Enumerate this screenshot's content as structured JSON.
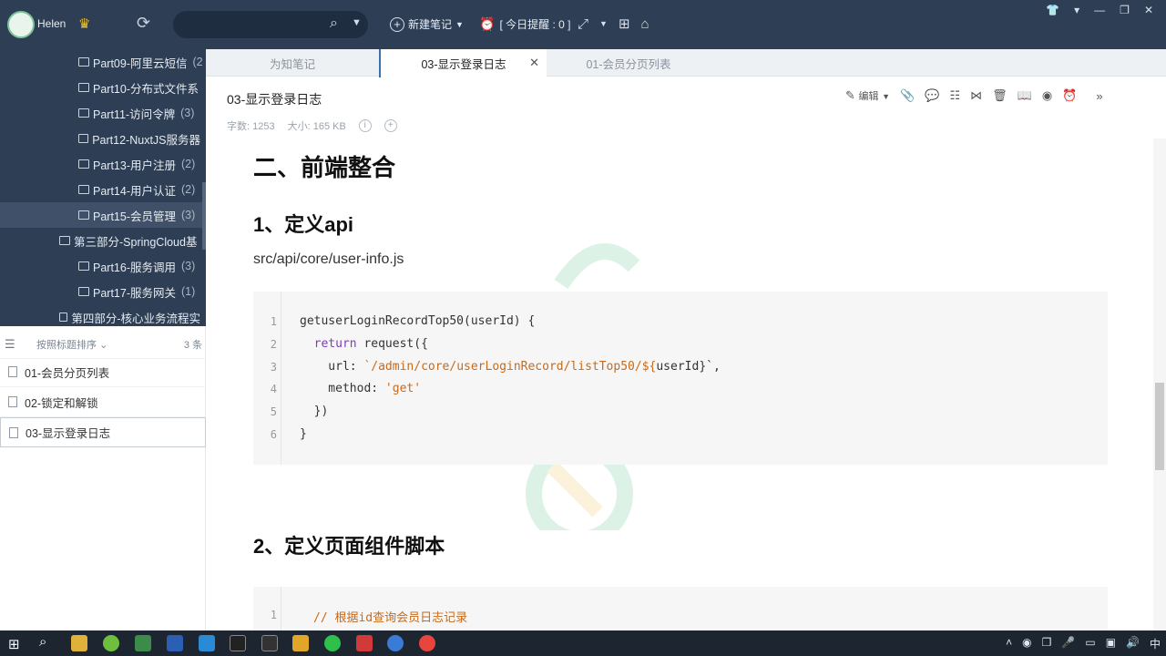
{
  "topbar": {
    "username": "Helen",
    "crown_icon": "crown-icon",
    "search_placeholder": "",
    "new_note_label": "新建笔记",
    "reminder_label": "[ 今日提醒 : 0 ]",
    "window_controls": [
      "shirt-icon",
      "menu-icon",
      "minimize-icon",
      "restore-icon",
      "close-icon"
    ]
  },
  "tree": {
    "items": [
      {
        "label": "Part09-阿里云短信",
        "count": "(2"
      },
      {
        "label": "Part10-分布式文件系",
        "count": ""
      },
      {
        "label": "Part11-访问令牌",
        "count": "(3)"
      },
      {
        "label": "Part12-NuxtJS服务器",
        "count": ""
      },
      {
        "label": "Part13-用户注册",
        "count": "(2)"
      },
      {
        "label": "Part14-用户认证",
        "count": "(2)"
      },
      {
        "label": "Part15-会员管理",
        "count": "(3)"
      },
      {
        "label": "第三部分-SpringCloud基",
        "count": ""
      },
      {
        "label": "Part16-服务调用",
        "count": "(3)"
      },
      {
        "label": "Part17-服务网关",
        "count": "(1)"
      },
      {
        "label": "第四部分-核心业务流程实",
        "count": ""
      }
    ]
  },
  "notelist": {
    "sort_label": "按照标题排序",
    "count_label": "3 条",
    "items": [
      "01-会员分页列表",
      "02-锁定和解锁",
      "03-显示登录日志"
    ]
  },
  "tabs": [
    {
      "label": "为知笔记"
    },
    {
      "label": "03-显示登录日志"
    },
    {
      "label": "01-会员分页列表"
    }
  ],
  "note": {
    "title": "03-显示登录日志",
    "word_count": "字数: 1253",
    "size": "大小: 165 KB",
    "edit_label": "编辑"
  },
  "content": {
    "h1": "二、前端整合",
    "h2_1": "1、定义api",
    "path": "src/api/core/user-info.js",
    "code_lines": [
      {
        "n": "1",
        "a": "getuserLoginRecordTop50(userId) {",
        "kw": "",
        "s": "",
        "b": ""
      },
      {
        "n": "2",
        "a": "  ",
        "kw": "return",
        "s": "",
        "b": " request({"
      },
      {
        "n": "3",
        "a": "    url: ",
        "kw": "",
        "s": "`/admin/core/userLoginRecord/listTop50/${",
        "b": "userId}`,"
      },
      {
        "n": "4",
        "a": "    method: ",
        "kw": "",
        "s": "'get'",
        "b": ""
      },
      {
        "n": "5",
        "a": "  })",
        "kw": "",
        "s": "",
        "b": ""
      },
      {
        "n": "6",
        "a": "}",
        "kw": "",
        "s": "",
        "b": ""
      }
    ],
    "h2_2": "2、定义页面组件脚本",
    "code2_line_no": "1",
    "code2_text": "// 根据id查询会员日志记录"
  },
  "taskbar": {
    "time_label": "中"
  },
  "colors": {
    "sidebar_bg": "#2d3e55",
    "accent": "#3a6fb0",
    "code_keyword": "#7a3fb5",
    "code_string": "#c76a1a"
  }
}
